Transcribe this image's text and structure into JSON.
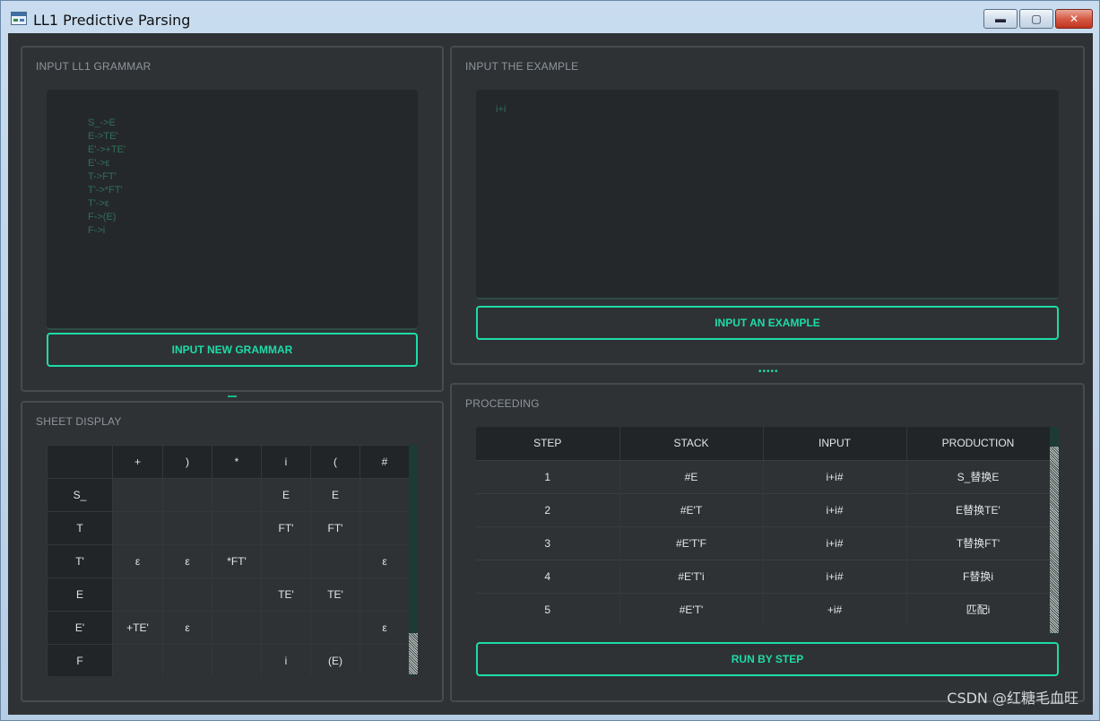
{
  "window": {
    "title": "LL1 Predictive Parsing",
    "minimize_glyph": "▬",
    "maximize_glyph": "▢",
    "close_glyph": "✕"
  },
  "grammar_panel": {
    "title": "INPUT LL1 GRAMMAR",
    "lines": [
      "S_->E",
      "E->TE'",
      "E'->+TE'",
      "E'->ε",
      "T->FT'",
      "T'->*FT'",
      "T'->ε",
      "F->(E)",
      "F->i"
    ],
    "button_label": "INPUT NEW GRAMMAR"
  },
  "example_panel": {
    "title": "INPUT THE EXAMPLE",
    "text": "i+i",
    "button_label": "INPUT AN EXAMPLE"
  },
  "sheet_panel": {
    "title": "SHEET DISPLAY",
    "columns": [
      "",
      "+",
      ")",
      "*",
      "i",
      "(",
      "#"
    ],
    "rows": [
      [
        "S_",
        "",
        "",
        "",
        "E",
        "E",
        ""
      ],
      [
        "T",
        "",
        "",
        "",
        "FT'",
        "FT'",
        ""
      ],
      [
        "T'",
        "ε",
        "ε",
        "*FT'",
        "",
        "",
        "ε"
      ],
      [
        "E",
        "",
        "",
        "",
        "TE'",
        "TE'",
        ""
      ],
      [
        "E'",
        "+TE'",
        "ε",
        "",
        "",
        "",
        "ε"
      ],
      [
        "F",
        "",
        "",
        "",
        "i",
        "(E)",
        ""
      ]
    ]
  },
  "proceeding_panel": {
    "title": "PROCEEDING",
    "columns": [
      "STEP",
      "STACK",
      "INPUT",
      "PRODUCTION"
    ],
    "rows": [
      [
        "1",
        "#E",
        "i+i#",
        "S_替换E"
      ],
      [
        "2",
        "#E'T",
        "i+i#",
        "E替换TE'"
      ],
      [
        "3",
        "#E'T'F",
        "i+i#",
        "T替换FT'"
      ],
      [
        "4",
        "#E'T'i",
        "i+i#",
        "F替换i"
      ],
      [
        "5",
        "#E'T'",
        "+i#",
        "匹配i"
      ]
    ],
    "button_label": "RUN BY STEP"
  },
  "watermark": "CSDN @红糖毛血旺",
  "colors": {
    "accent": "#1ddca8",
    "background": "#2f3235",
    "panel_border": "#474b4f",
    "header_bg": "#222528"
  }
}
